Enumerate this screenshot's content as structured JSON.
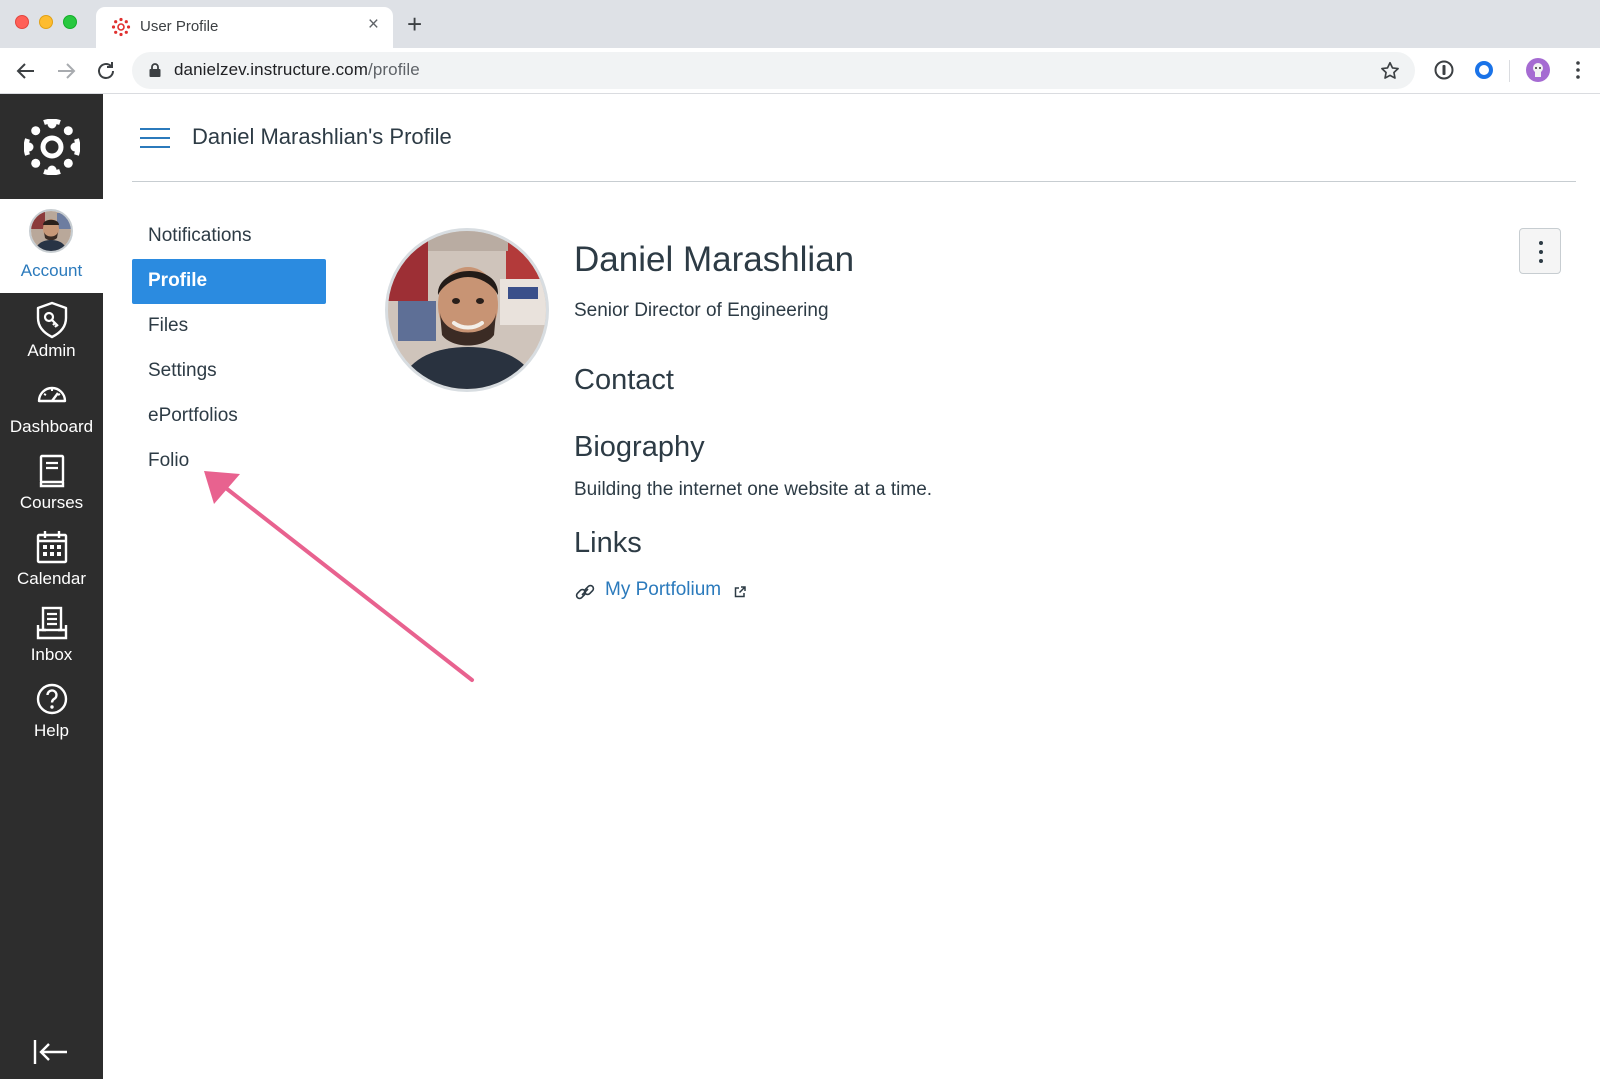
{
  "browser": {
    "tab_title": "User Profile",
    "tab_close": "×",
    "new_tab": "+",
    "url_host": "danielzev.instructure.com",
    "url_path": "/profile"
  },
  "global_nav": {
    "account_label": "Account",
    "items": [
      {
        "label": "Admin",
        "icon": "shield-icon"
      },
      {
        "label": "Dashboard",
        "icon": "speedometer-icon"
      },
      {
        "label": "Courses",
        "icon": "book-icon"
      },
      {
        "label": "Calendar",
        "icon": "calendar-icon"
      },
      {
        "label": "Inbox",
        "icon": "inbox-icon"
      },
      {
        "label": "Help",
        "icon": "help-icon"
      }
    ]
  },
  "header": {
    "title": "Daniel Marashlian's Profile"
  },
  "submenu": {
    "items": [
      "Notifications",
      "Profile",
      "Files",
      "Settings",
      "ePortfolios",
      "Folio"
    ],
    "active": "Profile"
  },
  "profile": {
    "name": "Daniel Marashlian",
    "job_title": "Senior Director of Engineering",
    "contact_heading": "Contact",
    "bio_heading": "Biography",
    "bio_text": "Building the internet one website at a time.",
    "links_heading": "Links",
    "link_label": "My Portfolium"
  },
  "colors": {
    "nav_bg": "#2d2d2d",
    "accent": "#2b8be0",
    "link": "#2b7abc",
    "annotation": "#e8628f"
  }
}
